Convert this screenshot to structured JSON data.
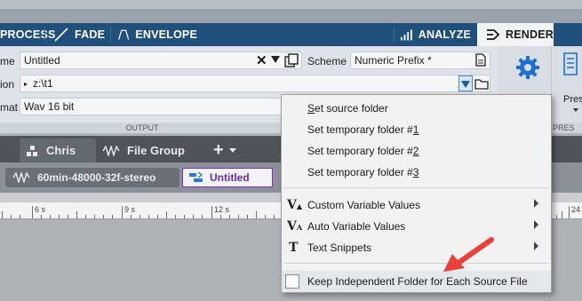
{
  "tabs": {
    "process": "PROCESS",
    "fade": "FADE",
    "envelope": "ENVELOPE",
    "analyze": "ANALYZE",
    "render": "RENDER"
  },
  "ribbon": {
    "name_label": "me",
    "name_value": "Untitled",
    "scheme_label": "Scheme",
    "scheme_value": "Numeric Prefix *",
    "location_label": "ion",
    "location_value": "z:\\t1",
    "format_label": "mat",
    "format_value": "Wav 16 bit",
    "output_band": "OUTPUT",
    "presets_label": "Pres",
    "presets_band": "PRES"
  },
  "workspace": {
    "tab_chris": "Chris",
    "tab_filegroup": "File Group",
    "add_symbol": "+"
  },
  "files": {
    "file1": "60min-48000-32f-stereo",
    "file2": "Untitled"
  },
  "ruler": {
    "labels": [
      "6 s",
      "9 s",
      "12 s",
      "24"
    ]
  },
  "menu": {
    "items": [
      {
        "prefix": "",
        "ul": "S",
        "rest": "et source folder"
      },
      {
        "prefix": "Set temporary folder #",
        "ul": "1",
        "rest": ""
      },
      {
        "prefix": "Set temporary folder #",
        "ul": "2",
        "rest": ""
      },
      {
        "prefix": "Set temporary folder #",
        "ul": "3",
        "rest": ""
      }
    ],
    "custom_vars": "Custom Variable Values",
    "auto_vars": "Auto Variable Values",
    "text_snippets": "Text Snippets",
    "keep_folder": "Keep Independent Folder for Each Source File"
  },
  "icons": {
    "gear": "gear-icon",
    "annotation_arrow_color": "#e8413a"
  }
}
